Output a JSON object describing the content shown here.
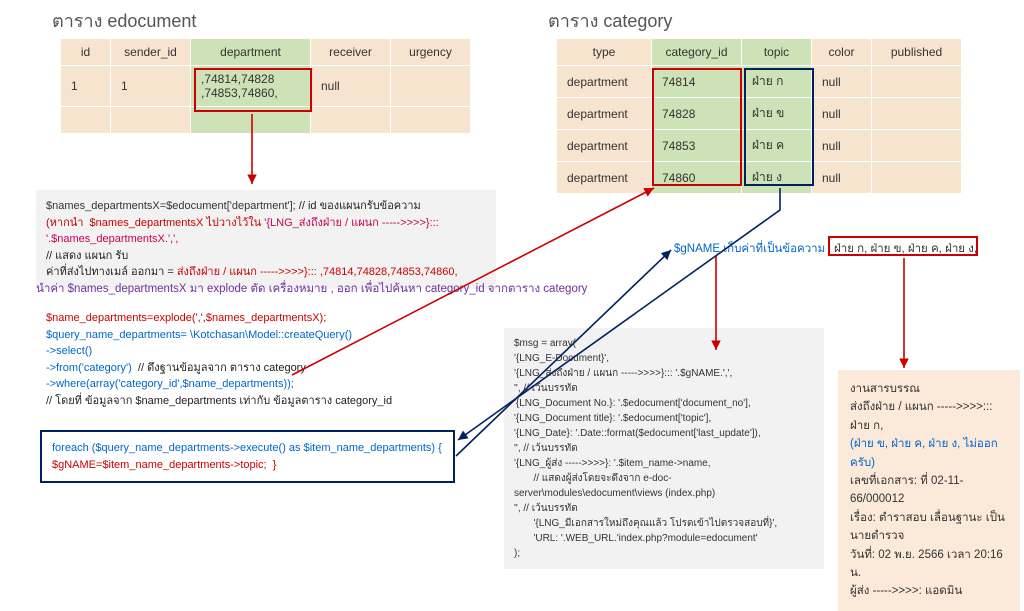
{
  "titles": {
    "left": "ตาราง edocument",
    "right": "ตาราง category"
  },
  "edocument": {
    "headers": {
      "id": "id",
      "sender_id": "sender_id",
      "department": "department",
      "receiver": "receiver",
      "urgency": "urgency"
    },
    "row": {
      "id": "1",
      "sender_id": "1",
      "department_line1": ",74814,74828",
      "department_line2": ",74853,74860,",
      "receiver": "null",
      "urgency": ""
    }
  },
  "category": {
    "headers": {
      "type": "type",
      "category_id": "category_id",
      "topic": "topic",
      "color": "color",
      "published": "published"
    },
    "rows": [
      {
        "type": "department",
        "category_id": "74814",
        "topic": "ฝ่าย ก",
        "color": "null",
        "published": ""
      },
      {
        "type": "department",
        "category_id": "74828",
        "topic": "ฝ่าย ข",
        "color": "null",
        "published": ""
      },
      {
        "type": "department",
        "category_id": "74853",
        "topic": "ฝ่าย ค",
        "color": "null",
        "published": ""
      },
      {
        "type": "department",
        "category_id": "74860",
        "topic": "ฝ่าย ง",
        "color": "null",
        "published": ""
      }
    ]
  },
  "code1": {
    "l1a": "$names_departmentsX=$edocument['department']; ",
    "l1b": "// id ของแผนกรับข้อความ",
    "l2a": "(หากนำ  $names_departmentsX ไปวางไว้ใน ",
    "l2b": "'{LNG_ส่งถึงฝ่าย / แผนก ----->>>>}::: '.$names_departmentsX.',',",
    "l3": "// แสดง แผนก รับ",
    "l4a": "ค่าที่ส่งไปทางเมล์ ออกมา = ",
    "l4b": "ส่งถึงฝ่าย / แผนก ----->>>>}::: ,74814,74828,74853,74860,"
  },
  "purple_note": "นำค่า $names_departmentsX มา explode ตัด เครื่องหมาย , ออก เพื่อไปค้นหา category_id จากตาราง category",
  "code2": {
    "l1": "$name_departments=explode(',',$names_departmentsX);",
    "l2": "$query_name_departments= \\Kotchasan\\Model::createQuery()",
    "l3": "->select()",
    "l4a": "->from('category')  ",
    "l4b": "// ดึงฐานข้อมูลจาก ตาราง category",
    "l5": "->where(array('category_id',$name_departments));",
    "l6": "// โดยที่ ข้อมูลจาก $name_departments เท่ากับ ข้อมูลตาราง category_id"
  },
  "code3": {
    "l1": "foreach ($query_name_departments->execute() as $item_name_departments) {",
    "l2": "$gNAME=$item_name_departments->topic;  }"
  },
  "annot": {
    "gname": "$gNAME เก็บค่าที่เป็นข้อความ",
    "topics": "ฝ่าย ก, ฝ่าย ข, ฝ่าย ค, ฝ่าย ง,"
  },
  "msg": {
    "l1": "$msg = array(",
    "l2": "'{LNG_E-Document}',",
    "l3": "'{LNG_ส่งถึงฝ่าย / แผนก ----->>>>}::: '.$gNAME.',',",
    "l4": "'', // เว้นบรรทัด",
    "l5": "'{LNG_Document No.}: '.$edocument['document_no'],",
    "l6": "'{LNG_Document title}: '.$edocument['topic'],",
    "l7": "'{LNG_Date}: '.Date::format($edocument['last_update']),",
    "l8": "'', // เว้นบรรทัด",
    "l9": "'{LNG_ผู้ส่ง ----->>>>}: '.$item_name->name,",
    "l10": "       // แสดงผู้ส่งโดยจะดึงจาก e-doc-server\\modules\\edocument\\views (index.php)",
    "l11": "'', // เว้นบรรทัด",
    "l12": "       '{LNG_มีเอกสารใหม่ถึงคุณแล้ว โปรดเข้าไปตรวจสอบที่}',",
    "l13": "       'URL: '.WEB_URL.'index.php?module=edocument'",
    "l14": ");"
  },
  "output": {
    "l1": "งานสารบรรณ",
    "l2": "ส่งถึงฝ่าย / แผนก ----->>>>::: ฝ่าย ก,",
    "l3": "(ฝ่าย ข, ฝ่าย ค, ฝ่าย ง, ไม่ออก ครับ)",
    "l4": "เลขที่เอกสาร: ที่ 02-11-66/000012",
    "l5": "เรื่อง: ตำราสอบ เลื่อนฐานะ เป็นนายตำรวจ",
    "l6": "วันที่: 02 พ.ย. 2566 เวลา 20:16 น.",
    "l7": "ผู้ส่ง ----->>>>: แอดมิน"
  }
}
